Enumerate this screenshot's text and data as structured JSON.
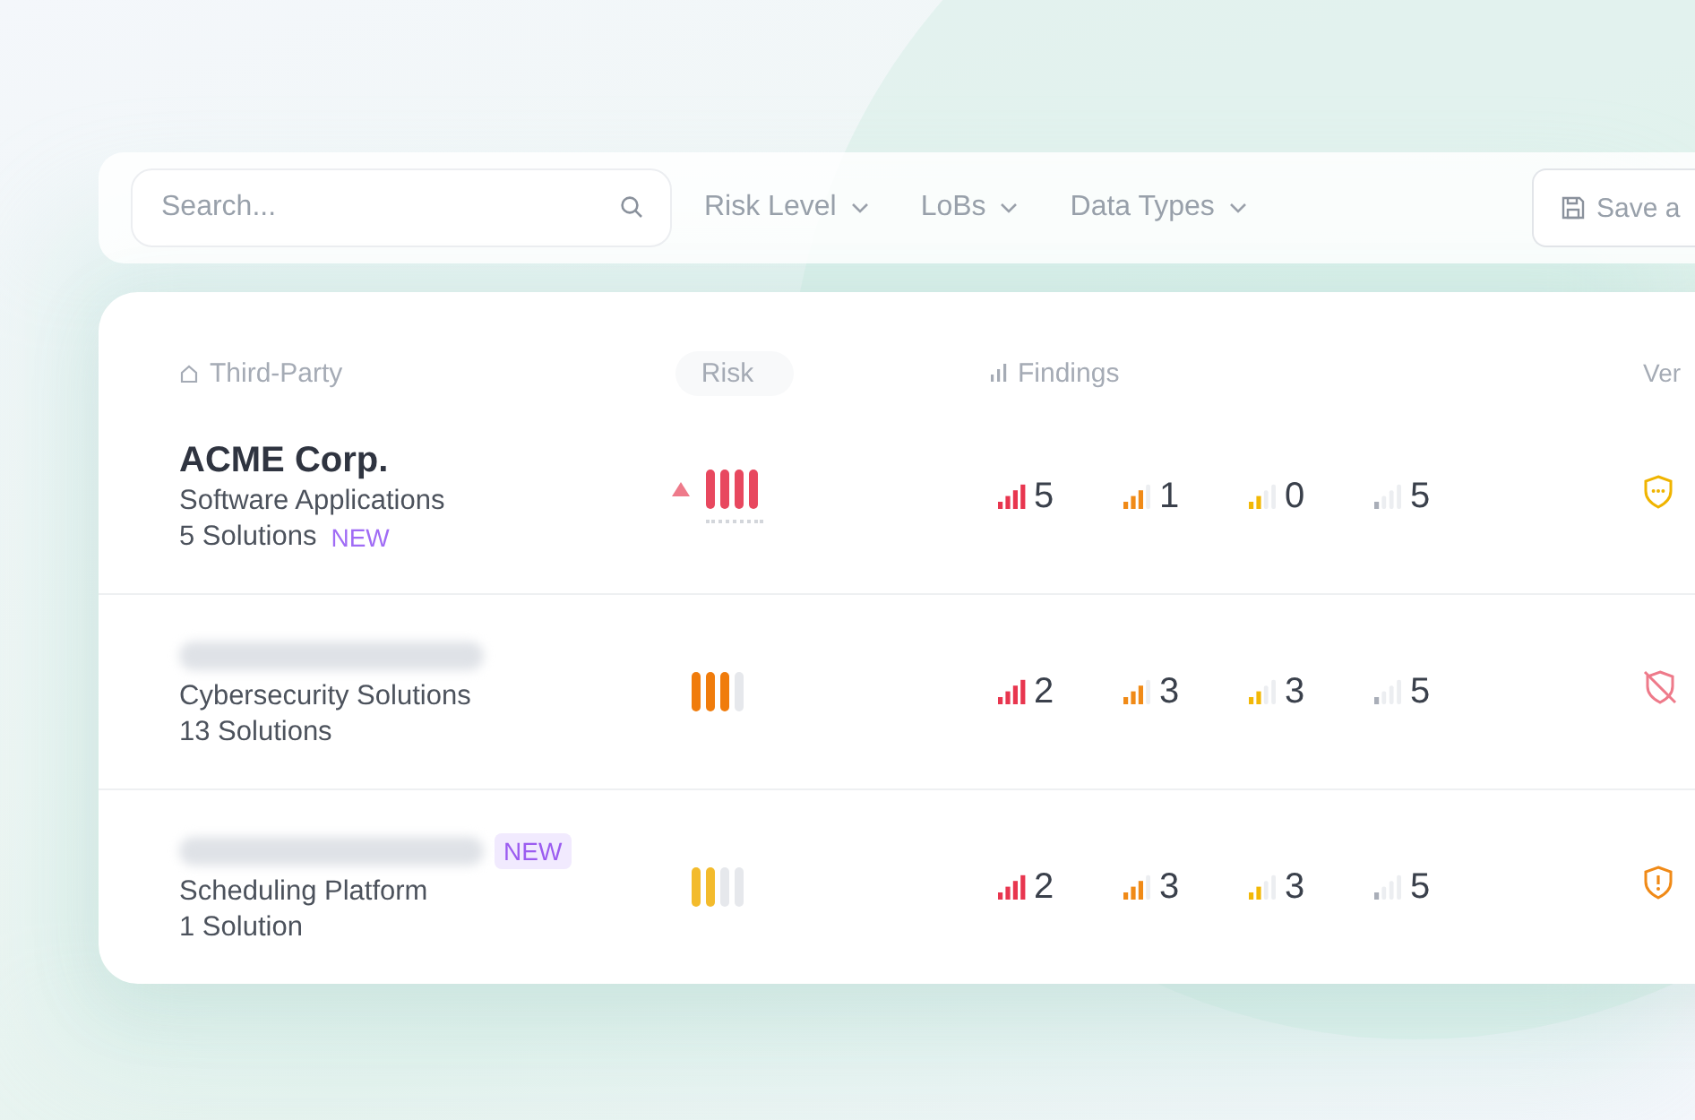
{
  "toolbar": {
    "search": {
      "placeholder": "Search..."
    },
    "filters": [
      {
        "label": "Risk Level"
      },
      {
        "label": "LoBs"
      },
      {
        "label": "Data Types"
      }
    ],
    "save_button": {
      "label": "Save a"
    }
  },
  "table": {
    "columns": [
      {
        "label": "Third-Party",
        "kind": "home"
      },
      {
        "label": "Risk",
        "kind": "plain"
      },
      {
        "label": "Findings",
        "kind": "bars"
      },
      {
        "label": "Ver",
        "kind": "plain"
      }
    ],
    "rows": [
      {
        "name": "ACME Corp.",
        "name_blurred": false,
        "category": "Software Applications",
        "solutions": "5 Solutions",
        "count_badge": "NEW",
        "risk": {
          "level": 1,
          "color": "#e8485f",
          "trend_up": true
        },
        "findings": [
          {
            "kind": "critical",
            "color": "#e8364f",
            "count": "5"
          },
          {
            "kind": "high",
            "color": "#f08a17",
            "count": "1"
          },
          {
            "kind": "medium",
            "color": "#f2b807",
            "count": "0"
          },
          {
            "kind": "low",
            "color": "#a9aeb8",
            "count": "5"
          }
        ],
        "verification": {
          "kind": "pending"
        }
      },
      {
        "name_blurred": true,
        "category": "Cybersecurity Solutions",
        "solutions": "13 Solutions",
        "risk": {
          "level": 0.75,
          "color": "#f07c0c",
          "trend_up": false
        },
        "findings": [
          {
            "kind": "critical",
            "color": "#e8364f",
            "count": "2"
          },
          {
            "kind": "high",
            "color": "#f08a17",
            "count": "3"
          },
          {
            "kind": "medium",
            "color": "#f2b807",
            "count": "3"
          },
          {
            "kind": "low",
            "color": "#a9aeb8",
            "count": "5"
          }
        ],
        "verification": {
          "kind": "unverified"
        }
      },
      {
        "name_blurred": true,
        "name_badge": "NEW",
        "category": "Scheduling Platform",
        "solutions": "1 Solution",
        "risk": {
          "level": 0.5,
          "color": "#f3bb2c",
          "trend_up": false
        },
        "findings": [
          {
            "kind": "critical",
            "color": "#e8364f",
            "count": "2"
          },
          {
            "kind": "high",
            "color": "#f08a17",
            "count": "3"
          },
          {
            "kind": "medium",
            "color": "#f2b807",
            "count": "3"
          },
          {
            "kind": "low",
            "color": "#a9aeb8",
            "count": "5"
          }
        ],
        "verification": {
          "kind": "warning"
        }
      }
    ]
  }
}
